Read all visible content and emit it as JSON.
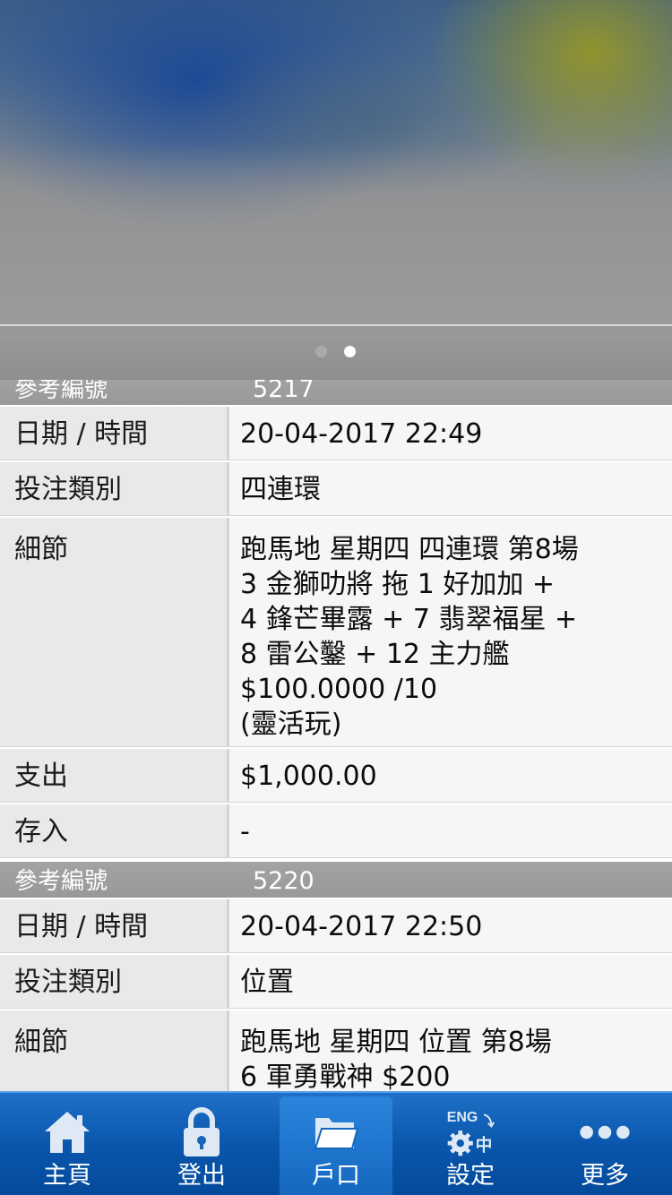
{
  "banner": {
    "slide_count": 2,
    "active_slide": 2
  },
  "records": [
    {
      "ref_label": "參考編號",
      "ref_no": "5217",
      "rows": [
        {
          "label": "日期 / 時間",
          "value": "20-04-2017 22:49"
        },
        {
          "label": "投注類別",
          "value": "四連環"
        },
        {
          "label": "細節",
          "lines": [
            "跑馬地 星期四 四連環 第8場",
            "3 金獅叻將 拖 1 好加加 +",
            "4 鋒芒畢露 + 7 翡翠福星 +",
            "8 雷公鑿 + 12 主力艦",
            "$100.0000 /10",
            "(靈活玩)"
          ]
        },
        {
          "label": "支出",
          "value": "$1,000.00"
        },
        {
          "label": "存入",
          "value": "-"
        }
      ]
    },
    {
      "ref_label": "參考編號",
      "ref_no": "5220",
      "rows": [
        {
          "label": "日期 / 時間",
          "value": "20-04-2017 22:50"
        },
        {
          "label": "投注類別",
          "value": "位置"
        },
        {
          "label": "細節",
          "lines": [
            "跑馬地 星期四 位置 第8場",
            "6 軍勇戰神 $200"
          ]
        }
      ]
    }
  ],
  "tabbar": {
    "selected": "account",
    "tabs": [
      {
        "id": "home",
        "label": "主頁",
        "icon": "home-icon"
      },
      {
        "id": "logout",
        "label": "登出",
        "icon": "padlock-icon"
      },
      {
        "id": "account",
        "label": "戶口",
        "icon": "folder-icon"
      },
      {
        "id": "settings",
        "label": "設定",
        "icon": "settings-language-icon",
        "icon_text_top": "ENG",
        "icon_text_bottom": "中"
      },
      {
        "id": "more",
        "label": "更多",
        "icon": "more-dots-icon"
      }
    ]
  },
  "colors": {
    "tabbar_top": "#1f70c8",
    "tabbar_bottom": "#044a9c",
    "header_grey": "#9e9e9e",
    "label_cell": "#e9e9e9",
    "value_cell": "#f6f6f6"
  }
}
